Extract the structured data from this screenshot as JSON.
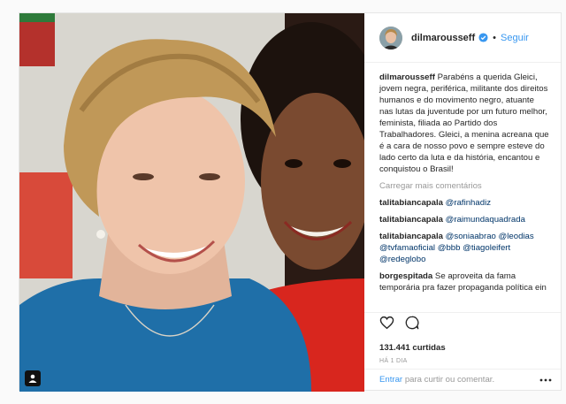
{
  "header": {
    "username": "dilmarousseff",
    "separator": "•",
    "follow_label": "Seguir"
  },
  "caption": {
    "username": "dilmarousseff",
    "text": "Parabéns a querida Gleici, jovem negra, periférica, militante dos direitos humanos e do movimento negro, atuante nas lutas da juventude por um futuro melhor, feminista, filiada ao Partido dos Trabalhadores. Gleici, a menina acreana que é a cara de nosso povo e sempre esteve do lado certo da luta e da história, encantou e conquistou o Brasil!"
  },
  "load_more": "Carregar mais comentários",
  "comments": [
    {
      "user": "talitabiancapala",
      "mentions": [
        "@rafinhadiz"
      ],
      "text": ""
    },
    {
      "user": "talitabiancapala",
      "mentions": [
        "@raimundaquadrada"
      ],
      "text": ""
    },
    {
      "user": "talitabiancapala",
      "mentions": [
        "@soniaabrao",
        "@leodias",
        "@tvfamaoficial",
        "@bbb",
        "@tiagoleifert",
        "@redeglobo"
      ],
      "text": ""
    },
    {
      "user": "borgespitada",
      "mentions": [],
      "text": "Se aproveita da fama temporária pra fazer propaganda política ein"
    }
  ],
  "likes": {
    "count": "131.441",
    "label": "curtidas"
  },
  "time": "HÁ 1 DIA",
  "footer": {
    "login_label": "Entrar",
    "rest_label": "para curtir ou comentar."
  },
  "colors": {
    "link": "#3897f0",
    "mention": "#003569",
    "verified": "#3897f0"
  }
}
